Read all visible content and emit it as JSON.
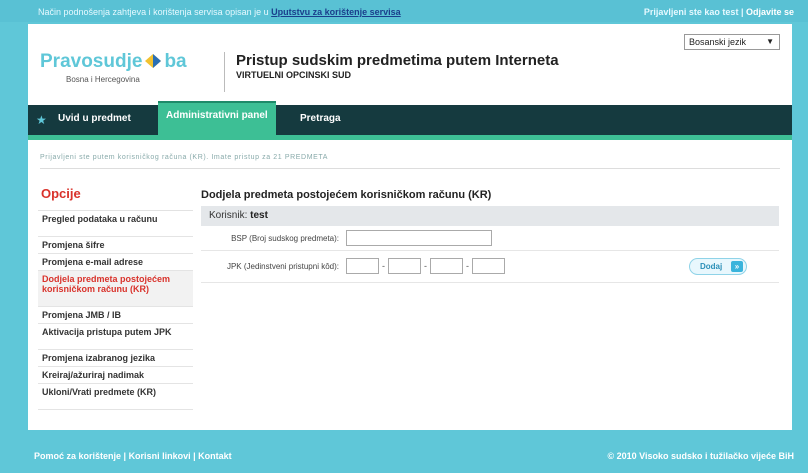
{
  "topbar": {
    "info_text": "Način podnošenja zahtjeva i korištenja servisa opisan je u ",
    "info_link": "Uputstvu za korištenje servisa",
    "login_text": "Prijavljeni ste kao test",
    "login_sep": " | ",
    "logout_link": "Odjavite se"
  },
  "header": {
    "logo_left": "Pravosudje",
    "logo_right": "ba",
    "logo_sub": "Bosna i Hercegovina",
    "title": "Pristup sudskim predmetima putem Interneta",
    "subtitle": "VIRTUELNI OPCINSKI SUD",
    "language": "Bosanski jezik",
    "language_arrow": "▼"
  },
  "nav": {
    "home_icon": "★",
    "tabs": [
      {
        "label": "Uvid u predmet"
      },
      {
        "label": "Administrativni panel"
      },
      {
        "label": "Pretraga"
      }
    ]
  },
  "notice": "Prijavljeni ste putem korisničkog računa (KR). Imate pristup za 21 PREDMETA",
  "sidebar": {
    "title": "Opcije",
    "items": [
      {
        "label": "Pregled podataka u računu"
      },
      {
        "label": "Promjena šifre"
      },
      {
        "label": "Promjena e-mail adrese"
      },
      {
        "label": "Dodjela predmeta postojećem korisničkom računu (KR)"
      },
      {
        "label": "Promjena JMB / IB"
      },
      {
        "label": "Aktivacija pristupa putem JPK"
      },
      {
        "label": "Promjena izabranog jezika"
      },
      {
        "label": "Kreiraj/ažuriraj nadimak"
      },
      {
        "label": "Ukloni/Vrati predmete (KR)"
      }
    ]
  },
  "main": {
    "heading": "Dodjela predmeta postojećem korisničkom računu (KR)",
    "user_label": "Korisnik: ",
    "user_value": "test",
    "bsp_label": "BSP (Broj sudskog predmeta):",
    "bsp_value": "",
    "jpk_label": "JPK (Jedinstveni pristupni kôd):",
    "jpk_values": [
      "",
      "",
      "",
      ""
    ],
    "jpk_sep": "-",
    "add_button": "Dodaj",
    "add_arrow": "»"
  },
  "footer": {
    "help": "Pomoć za korištenje",
    "links": "Korisni linkovi",
    "contact": "Kontakt",
    "sep": " | ",
    "copyright": "© 2010 Visoko sudsko i tužilačko vijeće BiH"
  },
  "colors": {
    "background": "#5fc7d8",
    "nav_dark": "#153a3f",
    "nav_active": "#3dbf95",
    "accent_red": "#d9322b"
  }
}
